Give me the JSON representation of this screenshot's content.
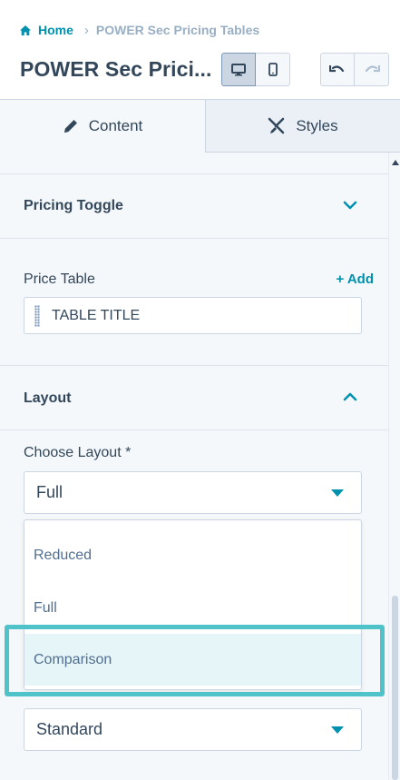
{
  "header": {
    "breadcrumb": {
      "home": "Home",
      "separator": "›",
      "current": "POWER Sec Pricing Tables"
    },
    "title": "POWER Sec Prici...",
    "device_buttons": [
      {
        "icon": "desktop-icon",
        "active": true
      },
      {
        "icon": "mobile-icon",
        "active": false
      }
    ],
    "history_buttons": [
      {
        "icon": "undo-icon"
      },
      {
        "icon": "redo-icon"
      }
    ]
  },
  "tabs": [
    {
      "label": "Content",
      "icon": "pencil-icon",
      "active": true
    },
    {
      "label": "Styles",
      "icon": "brush-icon",
      "active": false
    }
  ],
  "sections": {
    "pricing_toggle": {
      "title": "Pricing Toggle",
      "icon": "chevron-down-icon",
      "expanded": false
    },
    "price_table": {
      "label": "Price Table",
      "add_label": "+ Add",
      "items": [
        "TABLE TITLE"
      ]
    },
    "layout": {
      "title": "Layout",
      "icon": "chevron-up-icon",
      "expanded": true
    }
  },
  "choose_layout": {
    "label": "Choose Layout *",
    "value": "Full",
    "options": [
      "Reduced",
      "Full",
      "Comparison"
    ],
    "highlighted_option": "Comparison"
  },
  "second_select": {
    "value": "Standard"
  },
  "colors": {
    "accent": "#0091ae",
    "callout": "#4fc3c9",
    "text": "#33475b",
    "border": "#cbd6e2"
  }
}
